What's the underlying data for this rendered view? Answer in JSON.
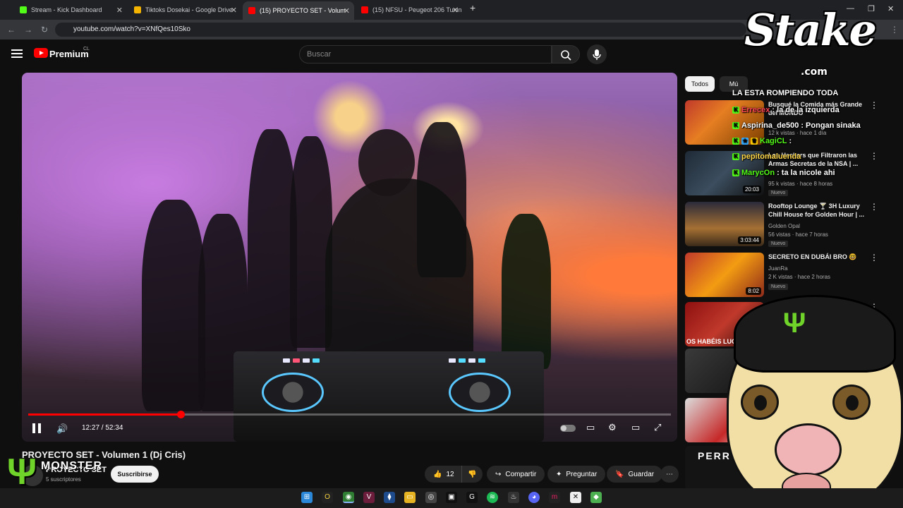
{
  "browser": {
    "tabs": [
      {
        "title": "Stream - Kick Dashboard",
        "active": false
      },
      {
        "title": "Tiktoks Dosekai - Google Drive",
        "active": false
      },
      {
        "title": "(15) PROYECTO SET - Volum",
        "active": true
      },
      {
        "title": "(15) NFSU - Peugeot 206 Tunin",
        "active": false
      }
    ],
    "url": "youtube.com/watch?v=XNfQes10Sko"
  },
  "youtube": {
    "brand": "Premium",
    "country_code": "CL",
    "search_placeholder": "Buscar"
  },
  "player": {
    "current_time": "12:27",
    "duration": "52:34",
    "timecode": "12:27 / 52:34",
    "progress_fraction": 0.237
  },
  "video": {
    "title": "PROYECTO SET - Volumen 1 (Dj Cris)",
    "channel": "PROYECTO SET",
    "subscribers": "5 suscriptores",
    "subscribe_label": "Suscribirse",
    "likes": "12",
    "share_label": "Compartir",
    "ask_label": "Preguntar",
    "save_label": "Guardar"
  },
  "sidebar": {
    "chips": [
      "Todos",
      "Mú"
    ],
    "recommendations": [
      {
        "title": "Busqué la Comida más Grande del MUNDO",
        "channel": "",
        "meta": "12 k vistas · hace 1 día",
        "duration": "",
        "badge": ""
      },
      {
        "title": "Los Hackers que Filtraron las Armas Secretas de la NSA | ...",
        "channel": "",
        "meta": "95 k vistas · hace 8 horas",
        "duration": "20:03",
        "badge": "Nuevo"
      },
      {
        "title": "Rooftop Lounge 🍸 3H Luxury Chill House for Golden Hour | ...",
        "channel": "Golden Opal",
        "meta": "56 vistas · hace 7 horas",
        "duration": "3:03:44",
        "badge": "Nuevo"
      },
      {
        "title": "SECRETO EN DUBÁI BRO 🤓",
        "channel": "JuanRa",
        "meta": "2 K vistas · hace 2 horas",
        "duration": "8:02",
        "badge": "Nuevo"
      }
    ],
    "thumb_texts": [
      "OS HABÉIS LUCIDO",
      "PERR"
    ]
  },
  "chat_overlay": [
    {
      "user": "",
      "message": "LA ESTA ROMPIENDO TODA"
    },
    {
      "user": "Errecex",
      "message": ": la de la izquierda"
    },
    {
      "user": "Aspirina_de500",
      "message": ": Pongan sinaka"
    },
    {
      "user": "KagiCL",
      "message": ":"
    },
    {
      "user": "pepitomaluenda",
      "message": ""
    },
    {
      "user": "MarycOn",
      "message": ": ta la nicole ahi"
    }
  ],
  "overlays": {
    "stake_text": "Stake",
    "stake_suffix": ".com",
    "monster_text": "MONSTER"
  },
  "colors": {
    "youtube_red": "#ff0000",
    "kick_green": "#53fc18",
    "monster_green": "#6fd32a",
    "background": "#0f0f0f"
  }
}
